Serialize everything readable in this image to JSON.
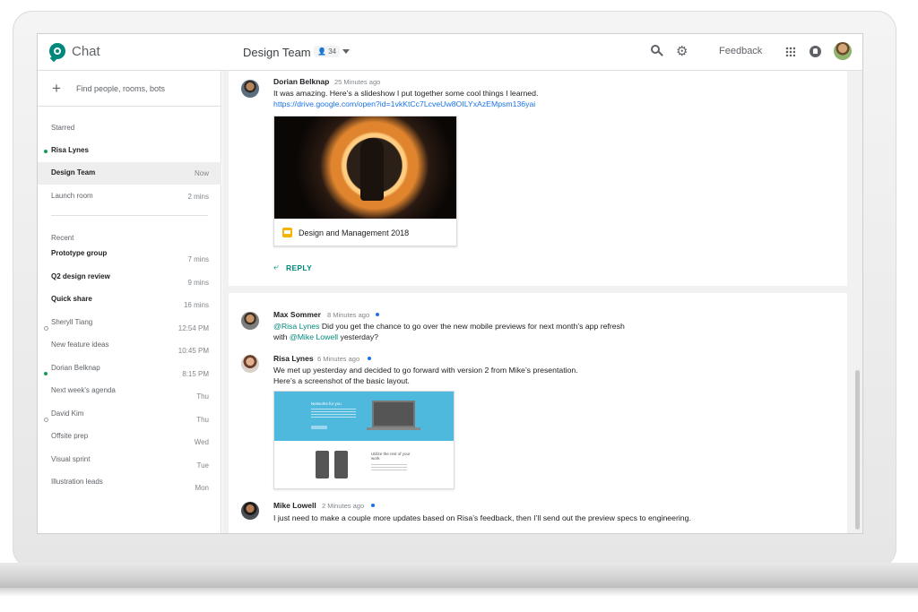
{
  "header": {
    "app_title": "Chat",
    "room_title": "Design Team",
    "member_count": "34",
    "feedback_label": "Feedback"
  },
  "sidebar": {
    "find_placeholder": "Find people, rooms, bots",
    "starred_label": "Starred",
    "starred": [
      {
        "name": "Risa Lynes",
        "time": "",
        "bold": true,
        "status": "online"
      },
      {
        "name": "Design Team",
        "time": "Now",
        "bold": true,
        "active": true
      },
      {
        "name": "Launch room",
        "time": "2 mins",
        "bold": false
      }
    ],
    "recent_label": "Recent",
    "recent": [
      {
        "name": "Prototype group",
        "time": "7 mins",
        "bold": true
      },
      {
        "name": "Q2 design review",
        "time": "9 mins",
        "bold": true
      },
      {
        "name": "Quick share",
        "time": "16 mins",
        "bold": true
      },
      {
        "name": "Sheryll Tiang",
        "time": "12:54 PM",
        "bold": false,
        "status": "offline"
      },
      {
        "name": "New feature ideas",
        "time": "10:45 PM",
        "bold": false
      },
      {
        "name": "Dorian Belknap",
        "time": "8:15 PM",
        "bold": false,
        "status": "online"
      },
      {
        "name": "Next week's agenda",
        "time": "Thu",
        "bold": false
      },
      {
        "name": "David Kim",
        "time": "Thu",
        "bold": false,
        "status": "offline"
      },
      {
        "name": "Offsite prep",
        "time": "Wed",
        "bold": false
      },
      {
        "name": "Visual sprint",
        "time": "Tue",
        "bold": false
      },
      {
        "name": "Illustration leads",
        "time": "Mon",
        "bold": false
      }
    ]
  },
  "threads": {
    "first": {
      "author": "Dorian Belknap",
      "time": "25 Minutes ago",
      "text": "It was amazing. Here’s a slideshow I put together some cool things I learned.",
      "link": "https://drive.google.com/open?id=1vkKtCc7LcveUw8OILYxAzEMpsm136yai",
      "attachment_title": "Design and Management 2018",
      "reply_label": "REPLY"
    },
    "second": {
      "messages": [
        {
          "author": "Max Sommer",
          "time": "8 Minutes ago",
          "mention_1": "@Risa Lynes",
          "text_1": " Did you get the chance to go over the new mobile previews for next month’s app refresh",
          "text_2_prefix": "with ",
          "mention_2": "@Mike Lowell",
          "text_2_suffix": " yesterday?"
        },
        {
          "author": "Risa Lynes",
          "time": "6 Minutes ago",
          "line_1": "We met up yesterday and decided to go forward with version 2 from Mike’s presentation.",
          "line_2": "Here’s a screenshot of the basic layout.",
          "shot_title": "Networks for you",
          "shot_subtitle": "Utilize the rest of your work"
        },
        {
          "author": "Mike Lowell",
          "time": "2 Minutes ago",
          "text": "I just need to make a couple more updates based on Risa’s feedback, then I’ll send out the preview specs to engineering."
        }
      ]
    }
  },
  "icons": [
    "chat-logo-icon",
    "person-icon",
    "chevron-down-icon",
    "search-icon",
    "gear-icon",
    "feedback-icon",
    "apps-grid-icon",
    "notifications-icon",
    "plus-icon",
    "slides-icon",
    "reply-arrow-icon"
  ],
  "colors": {
    "accent": "#00897b",
    "link": "#1a73e8",
    "online": "#0f9d58"
  }
}
